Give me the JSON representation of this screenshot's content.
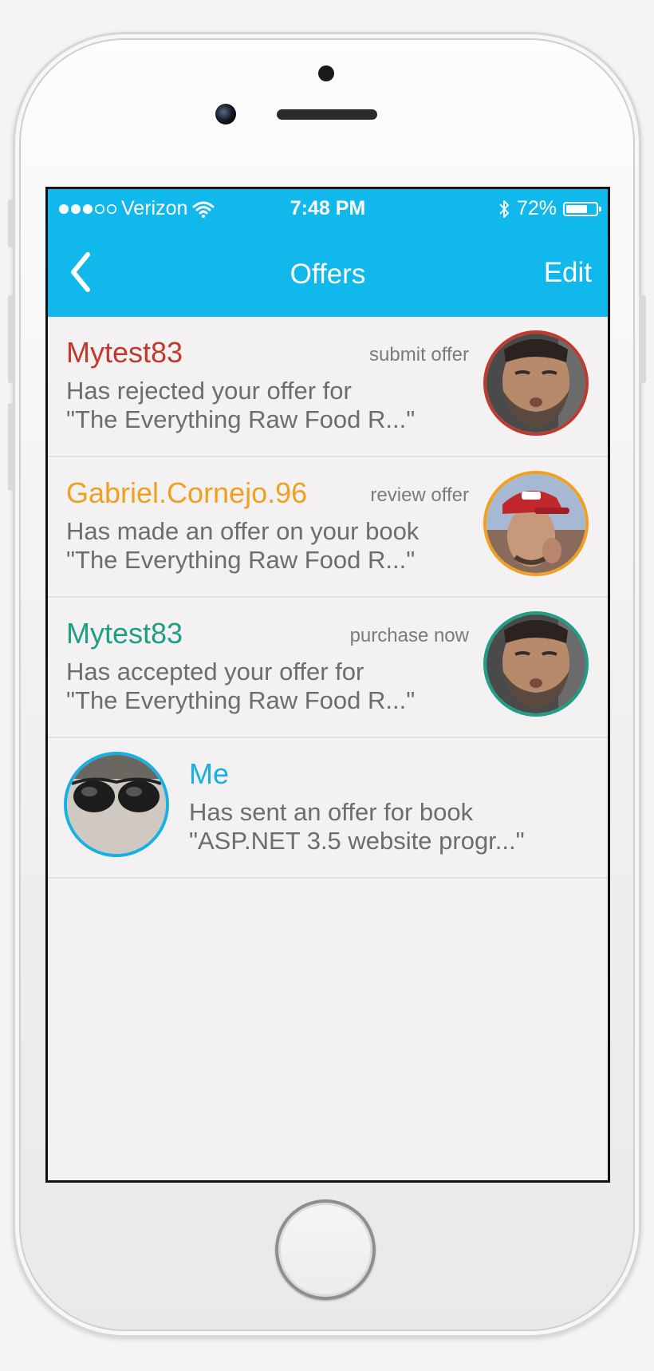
{
  "status_bar": {
    "carrier": "Verizon",
    "time": "7:48 PM",
    "battery": "72%",
    "battery_level": 0.72,
    "signal_bars": 3,
    "signal_total": 5
  },
  "nav": {
    "title": "Offers",
    "edit_label": "Edit"
  },
  "colors": {
    "accent": "#10b8ec",
    "rejected": "#c0392b",
    "review": "#f0a020",
    "accepted": "#1e9e84",
    "me": "#17b0e4"
  },
  "offers": [
    {
      "name": "Mytest83",
      "action": "submit offer",
      "line1": "Has rejected your offer for",
      "line2": "\"The Everything Raw Food R...\""
    },
    {
      "name": "Gabriel.Cornejo.96",
      "action": "review offer",
      "line1": "Has made an offer on your book",
      "line2": "\"The Everything Raw Food R...\""
    },
    {
      "name": "Mytest83",
      "action": "purchase now",
      "line1": "Has accepted your offer for",
      "line2": "\"The Everything Raw Food R...\""
    },
    {
      "name": "Me",
      "line1": "Has sent an offer for book",
      "line2": "\"ASP.NET 3.5 website progr...\""
    }
  ]
}
